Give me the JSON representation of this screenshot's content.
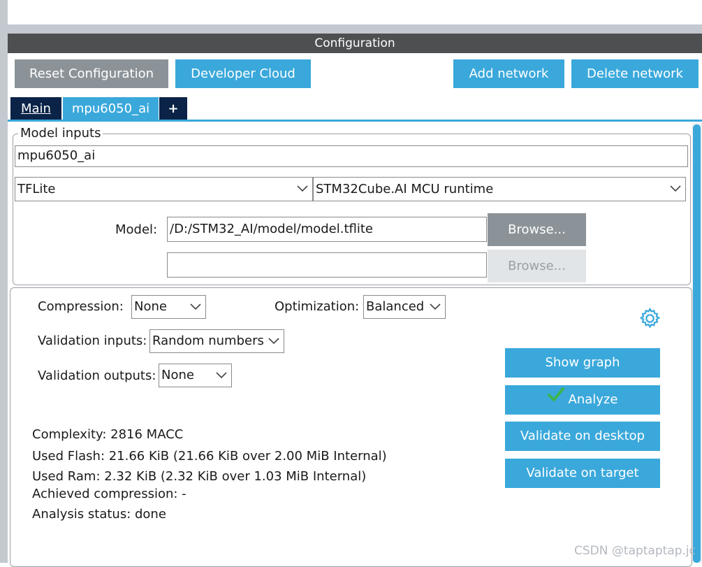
{
  "window": {
    "title": "Configuration"
  },
  "toolbar": {
    "reset_label": "Reset Configuration",
    "developer_cloud_label": "Developer Cloud",
    "add_network_label": "Add network",
    "delete_network_label": "Delete network"
  },
  "tabs": [
    {
      "label": "Main",
      "selected": false
    },
    {
      "label": "mpu6050_ai",
      "selected": true
    },
    {
      "label": "+"
    }
  ],
  "model_inputs": {
    "legend": "Model inputs",
    "name_value": "mpu6050_ai",
    "framework_value": "TFLite",
    "runtime_value": "STM32Cube.AI MCU runtime",
    "model_label": "Model:",
    "model_path_value": "/D:/STM32_AI/model/model.tflite",
    "model_path_2_value": "",
    "browse_label": "Browse...",
    "browse_2_label": "Browse..."
  },
  "settings": {
    "compression_label": "Compression:",
    "compression_value": "None",
    "optimization_label": "Optimization:",
    "optimization_value": "Balanced",
    "validation_inputs_label": "Validation inputs:",
    "validation_inputs_value": "Random numbers",
    "validation_outputs_label": "Validation outputs:",
    "validation_outputs_value": "None"
  },
  "actions": {
    "show_graph_label": "Show graph",
    "analyze_label": "Analyze",
    "validate_desktop_label": "Validate on desktop",
    "validate_target_label": "Validate on target"
  },
  "results": {
    "complexity": "Complexity:  2816 MACC",
    "used_flash": "Used Flash: 21.66 KiB (21.66 KiB over 2.00 MiB Internal)",
    "used_ram": "Used Ram: 2.32 KiB (2.32 KiB over 1.03 MiB Internal)",
    "achieved_compression": "Achieved compression: -",
    "analysis_status": "Analysis status: done"
  },
  "watermark": "CSDN @taptaptap.jc",
  "colors": {
    "accent": "#3aa8db",
    "title_bar": "#4d4f51",
    "tab_dark": "#0a2347",
    "button_gray": "#8c9398",
    "check_green": "#3cb44b"
  },
  "icons": [
    "gear-icon",
    "chevron-down-icon",
    "check-icon"
  ]
}
